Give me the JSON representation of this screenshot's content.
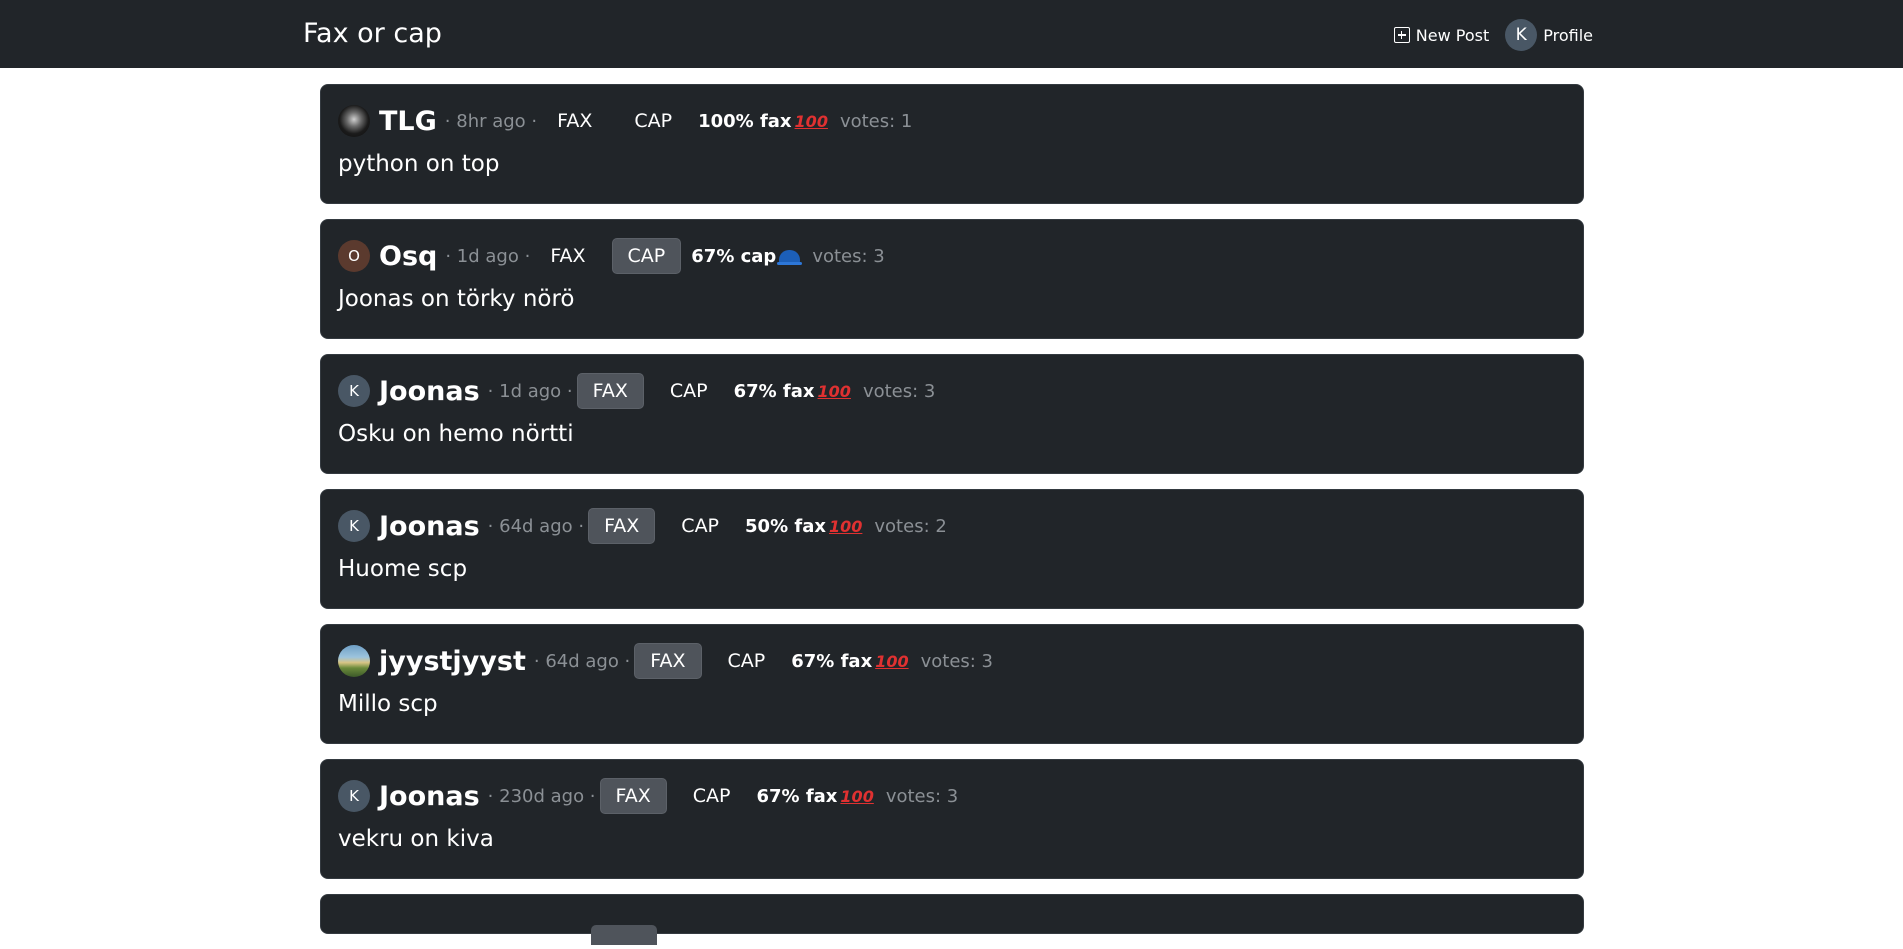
{
  "app": {
    "title": "Fax or cap",
    "new_post_label": "New Post",
    "profile_label": "Profile",
    "profile_initial": "K"
  },
  "colors": {
    "navbar": "#212529",
    "card": "#212529",
    "selected_vote": "#4f545b",
    "muted_text": "#8b9095"
  },
  "posts": [
    {
      "avatar": {
        "type": "image",
        "icon": "dark-profile-picture"
      },
      "username": "TLG",
      "time": "· 8hr ago ·",
      "fax_label": "FAX",
      "cap_label": "CAP",
      "selected": "",
      "result": "100% fax",
      "result_icon": "100-icon",
      "votes": "votes: 1",
      "text": "python on top"
    },
    {
      "avatar": {
        "type": "letter",
        "letter": "O"
      },
      "username": "Osq",
      "time": "· 1d ago ·",
      "fax_label": "FAX",
      "cap_label": "CAP",
      "selected": "cap",
      "result": "67% cap",
      "result_icon": "cap-icon",
      "votes": "votes: 3",
      "text": "Joonas on törky nörö"
    },
    {
      "avatar": {
        "type": "letter",
        "letter": "K"
      },
      "username": "Joonas",
      "time": "· 1d ago ·",
      "fax_label": "FAX",
      "cap_label": "CAP",
      "selected": "fax",
      "result": "67% fax",
      "result_icon": "100-icon",
      "votes": "votes: 3",
      "text": "Osku on hemo nörtti"
    },
    {
      "avatar": {
        "type": "letter",
        "letter": "K"
      },
      "username": "Joonas",
      "time": "· 64d ago ·",
      "fax_label": "FAX",
      "cap_label": "CAP",
      "selected": "fax",
      "result": "50% fax",
      "result_icon": "100-icon",
      "votes": "votes: 2",
      "text": "Huome scp"
    },
    {
      "avatar": {
        "type": "image",
        "icon": "landscape-profile-picture"
      },
      "username": "jyystjyyst",
      "time": "· 64d ago ·",
      "fax_label": "FAX",
      "cap_label": "CAP",
      "selected": "fax",
      "result": "67% fax",
      "result_icon": "100-icon",
      "votes": "votes: 3",
      "text": "Millo scp"
    },
    {
      "avatar": {
        "type": "letter",
        "letter": "K"
      },
      "username": "Joonas",
      "time": "· 230d ago ·",
      "fax_label": "FAX",
      "cap_label": "CAP",
      "selected": "fax",
      "result": "67% fax",
      "result_icon": "100-icon",
      "votes": "votes: 3",
      "text": "vekru on kiva"
    }
  ],
  "glyphs": {
    "hundred": "100"
  }
}
